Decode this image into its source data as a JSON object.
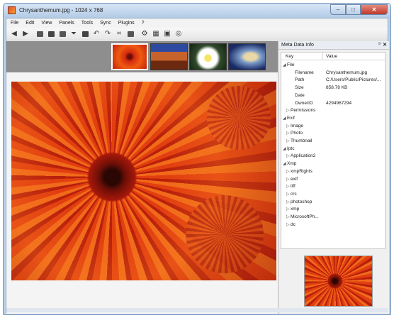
{
  "window": {
    "title": "Chrysanthemum.jpg - 1024 x 768",
    "controls": {
      "minimize": "–",
      "maximize": "□",
      "close": "✕"
    }
  },
  "menu": [
    "File",
    "Edit",
    "View",
    "Panels",
    "Tools",
    "Sync",
    "Plugins",
    "?"
  ],
  "toolbar": {
    "icons": [
      "back-arrow-icon",
      "forward-arrow-icon",
      "open-folder-icon",
      "save-icon",
      "copy-icon",
      "filter-icon",
      "print-icon",
      "rotate-left-icon",
      "rotate-right-icon",
      "crop-icon",
      "resize-icon",
      "settings-icon",
      "grid-icon",
      "fullscreen-icon",
      "info-icon"
    ]
  },
  "filmstrip": {
    "thumbnails": [
      "chrysanthemum",
      "desert",
      "white-flower",
      "jellyfish"
    ]
  },
  "meta_panel": {
    "title": "Meta Data Info",
    "pin": "ᵖ",
    "close": "✕",
    "columns": {
      "key": "Key",
      "value": "Value"
    },
    "rows": [
      {
        "arrow": "◢",
        "key": "File",
        "value": "",
        "indent": 0
      },
      {
        "arrow": "",
        "key": "Filename",
        "value": "Chrysanthemum.jpg",
        "indent": 2
      },
      {
        "arrow": "",
        "key": "Path",
        "value": "C:/Users/Public/Pictures/...",
        "indent": 2
      },
      {
        "arrow": "",
        "key": "Size",
        "value": "858.78 KB",
        "indent": 2
      },
      {
        "arrow": "",
        "key": "Date",
        "value": "",
        "indent": 2
      },
      {
        "arrow": "",
        "key": "OwnerID",
        "value": "4294967294",
        "indent": 2
      },
      {
        "arrow": "▷",
        "key": "Permissions",
        "value": "",
        "indent": 1
      },
      {
        "arrow": "◢",
        "key": "Exif",
        "value": "",
        "indent": 0
      },
      {
        "arrow": "▷",
        "key": "Image",
        "value": "",
        "indent": 1
      },
      {
        "arrow": "▷",
        "key": "Photo",
        "value": "",
        "indent": 1
      },
      {
        "arrow": "▷",
        "key": "Thumbnail",
        "value": "",
        "indent": 1
      },
      {
        "arrow": "◢",
        "key": "Iptc",
        "value": "",
        "indent": 0
      },
      {
        "arrow": "▷",
        "key": "Application2",
        "value": "",
        "indent": 1
      },
      {
        "arrow": "◢",
        "key": "Xmp",
        "value": "",
        "indent": 0
      },
      {
        "arrow": "▷",
        "key": "xmpRights",
        "value": "",
        "indent": 1
      },
      {
        "arrow": "▷",
        "key": "exif",
        "value": "",
        "indent": 1
      },
      {
        "arrow": "▷",
        "key": "tiff",
        "value": "",
        "indent": 1
      },
      {
        "arrow": "▷",
        "key": "crs",
        "value": "",
        "indent": 1
      },
      {
        "arrow": "▷",
        "key": "photoshop",
        "value": "",
        "indent": 1
      },
      {
        "arrow": "▷",
        "key": "xmp",
        "value": "",
        "indent": 1
      },
      {
        "arrow": "▷",
        "key": "MicrosoftPh...",
        "value": "",
        "indent": 1
      },
      {
        "arrow": "▷",
        "key": "dc",
        "value": "",
        "indent": 1
      }
    ]
  }
}
